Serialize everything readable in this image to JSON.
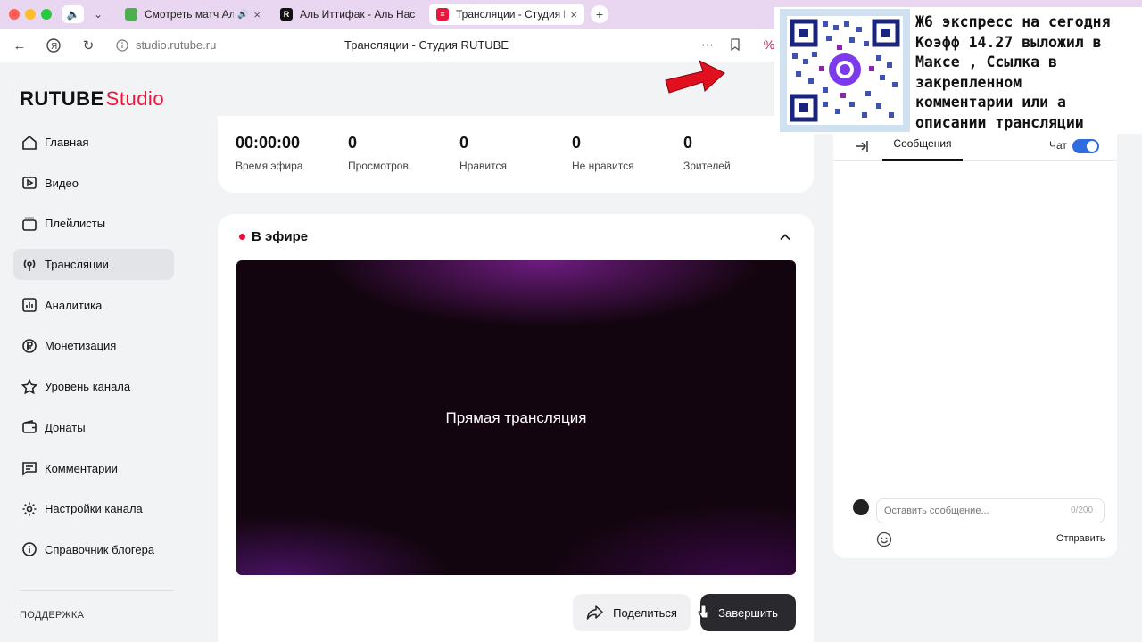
{
  "browser": {
    "tabs": [
      {
        "label": "Смотреть матч Аль",
        "color": "#4caf50"
      },
      {
        "label": "Аль Иттифак - Аль Наср Р",
        "color": "#111111"
      },
      {
        "label": "Трансляции - Студия R",
        "color": "#ed143b",
        "active": true
      }
    ],
    "url": "studio.rutube.ru",
    "page_title": "Трансляции - Студия RUTUBE"
  },
  "logo": {
    "brand": "RUTUBE",
    "product": "Studio"
  },
  "sidebar": {
    "items": [
      {
        "label": "Главная",
        "icon": "home-icon"
      },
      {
        "label": "Видео",
        "icon": "video-icon"
      },
      {
        "label": "Плейлисты",
        "icon": "playlist-icon"
      },
      {
        "label": "Трансляции",
        "icon": "broadcast-icon",
        "active": true
      },
      {
        "label": "Аналитика",
        "icon": "analytics-icon"
      },
      {
        "label": "Монетизация",
        "icon": "ruble-icon"
      },
      {
        "label": "Уровень канала",
        "icon": "star-icon"
      },
      {
        "label": "Донаты",
        "icon": "wallet-icon"
      },
      {
        "label": "Комментарии",
        "icon": "comment-icon"
      },
      {
        "label": "Настройки канала",
        "icon": "gear-icon"
      },
      {
        "label": "Справочник блогера",
        "icon": "info-icon"
      }
    ],
    "support_label": "ПОДДЕРЖКА"
  },
  "stats": [
    {
      "value": "00:00:00",
      "label": "Время эфира"
    },
    {
      "value": "0",
      "label": "Просмотров"
    },
    {
      "value": "0",
      "label": "Нравится"
    },
    {
      "value": "0",
      "label": "Не нравится"
    },
    {
      "value": "0",
      "label": "Зрителей"
    }
  ],
  "live": {
    "title": "В эфире",
    "player_text": "Прямая трансляция",
    "share_label": "Поделиться",
    "end_label": "Завершить"
  },
  "chat": {
    "tab_messages": "Сообщения",
    "chat_label": "Чат",
    "placeholder": "Оставить сообщение...",
    "counter": "0/200",
    "send_label": "Отправить"
  },
  "overlay": {
    "lines": [
      "Ж6 экспресс на сегодня",
      "Коэфф 14.27 выложил в",
      "Максе , Ссылка в",
      "закрепленном",
      "комментарии или а",
      "описании трансляции"
    ]
  },
  "colors": {
    "accent": "#ed143b",
    "toggle": "#2f6ce0",
    "tabbar": "#e9d6f0"
  }
}
